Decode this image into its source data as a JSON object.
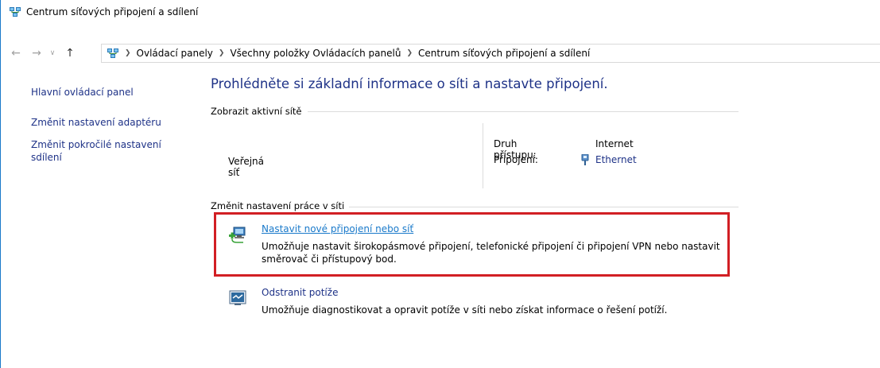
{
  "window": {
    "title": "Centrum síťových připojení a sdílení",
    "title_icon": "network-center-icon"
  },
  "addressbar": {
    "back_icon": "back-arrow-icon",
    "forward_icon": "forward-arrow-icon",
    "recent_icon": "chevron-down-icon",
    "up_icon": "up-arrow-icon",
    "breadcrumbs": [
      "Ovládací panely",
      "Všechny položky Ovládacích panelů",
      "Centrum síťových připojení a sdílení"
    ]
  },
  "sidebar": {
    "items": [
      {
        "label": "Hlavní ovládací panel"
      },
      {
        "label": "Změnit nastavení adaptéru"
      },
      {
        "label": "Změnit pokročilé nastavení sdílení"
      }
    ]
  },
  "main": {
    "heading": "Prohlédněte si základní informace o síti a nastavte připojení.",
    "active_networks": {
      "section_title": "Zobrazit aktivní sítě",
      "network_name": "Veřejná síť",
      "access_type_label": "Druh přístupu:",
      "access_type_value": "Internet",
      "connections_label": "Připojení:",
      "connections_value": "Ethernet"
    },
    "change_settings": {
      "section_title": "Změnit nastavení práce v síti",
      "tasks": [
        {
          "label": "Nastavit nové připojení nebo síť",
          "description": "Umožňuje nastavit širokopásmové připojení, telefonické připojení či připojení VPN nebo nastavit směrovač či přístupový bod."
        },
        {
          "label": "Odstranit potíže",
          "description": "Umožňuje diagnostikovat a opravit potíže v síti nebo získat informace o řešení potíží."
        }
      ]
    }
  },
  "colors": {
    "link": "#1e3287",
    "hover_link": "#1979ca",
    "highlight_border": "#d21f24"
  }
}
